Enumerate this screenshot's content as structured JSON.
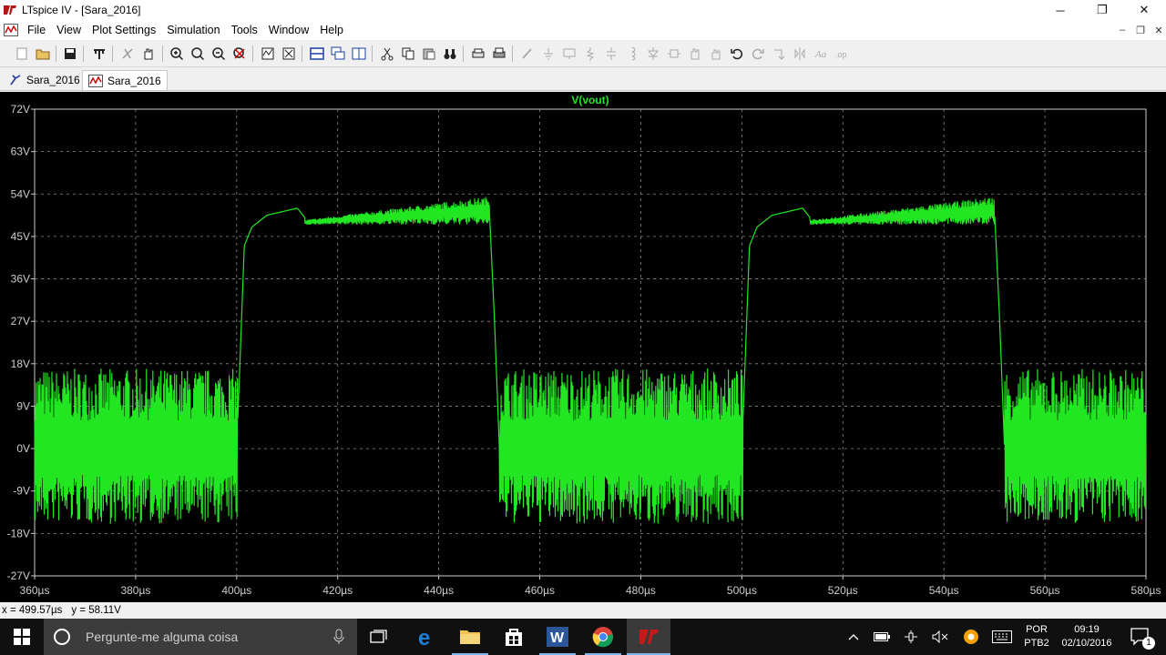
{
  "window": {
    "title": "LTspice IV - [Sara_2016]",
    "controls": {
      "minimize": "─",
      "maximize": "❐",
      "close": "✕"
    }
  },
  "menu": {
    "items": [
      "File",
      "View",
      "Plot Settings",
      "Simulation",
      "Tools",
      "Window",
      "Help"
    ]
  },
  "mdi_controls": {
    "minimize": "–",
    "restore": "❐",
    "close": "✕"
  },
  "tabs": [
    {
      "label": "Sara_2016",
      "icon": "schematic-icon",
      "active": false
    },
    {
      "label": "Sara_2016",
      "icon": "waveform-icon",
      "active": true
    }
  ],
  "plot": {
    "trace_label": "V(vout)",
    "trace_color": "#22e622",
    "axis_color": "#cccccc",
    "background": "#000000"
  },
  "chart_data": {
    "type": "line",
    "title": "V(vout)",
    "xlabel": "",
    "ylabel": "",
    "x_ticks": [
      "360µs",
      "380µs",
      "400µs",
      "420µs",
      "440µs",
      "460µs",
      "480µs",
      "500µs",
      "520µs",
      "540µs",
      "560µs",
      "580µs"
    ],
    "y_ticks": [
      "72V",
      "63V",
      "54V",
      "45V",
      "36V",
      "27V",
      "18V",
      "9V",
      "0V",
      "-9V",
      "-18V",
      "-27V"
    ],
    "xlim": [
      360,
      580
    ],
    "ylim": [
      -27,
      72
    ],
    "grid": true,
    "series": [
      {
        "name": "V(vout)",
        "description_points": [
          {
            "x": 360,
            "y": 0
          },
          {
            "x": 400,
            "y": 0
          },
          {
            "x": 400.5,
            "y": 14
          },
          {
            "x": 401.5,
            "y": 43
          },
          {
            "x": 403,
            "y": 47
          },
          {
            "x": 406,
            "y": 49.5
          },
          {
            "x": 412,
            "y": 51
          },
          {
            "x": 413.5,
            "y": 49
          },
          {
            "x": 420,
            "y": 50.5
          },
          {
            "x": 450,
            "y": 51
          },
          {
            "x": 451,
            "y": 28
          },
          {
            "x": 452,
            "y": 0
          },
          {
            "x": 500,
            "y": 0
          },
          {
            "x": 500.5,
            "y": 14
          },
          {
            "x": 501.5,
            "y": 43
          },
          {
            "x": 503,
            "y": 47
          },
          {
            "x": 506,
            "y": 49.5
          },
          {
            "x": 512,
            "y": 51
          },
          {
            "x": 513.5,
            "y": 49
          },
          {
            "x": 520,
            "y": 50.5
          },
          {
            "x": 550,
            "y": 51
          },
          {
            "x": 551,
            "y": 28
          },
          {
            "x": 552,
            "y": 0
          },
          {
            "x": 580,
            "y": 0
          }
        ],
        "low_ripple_range": [
          -16,
          17
        ],
        "high_ripple_range": [
          46,
          54
        ]
      }
    ]
  },
  "status": {
    "x_readout": "x = 499.57µs",
    "y_readout": "y = 58.11V"
  },
  "taskbar": {
    "search_placeholder": "Pergunte-me alguma coisa",
    "lang_top": "POR",
    "lang_bottom": "PTB2",
    "time": "09:19",
    "date": "02/10/2016",
    "notification_count": "1"
  }
}
